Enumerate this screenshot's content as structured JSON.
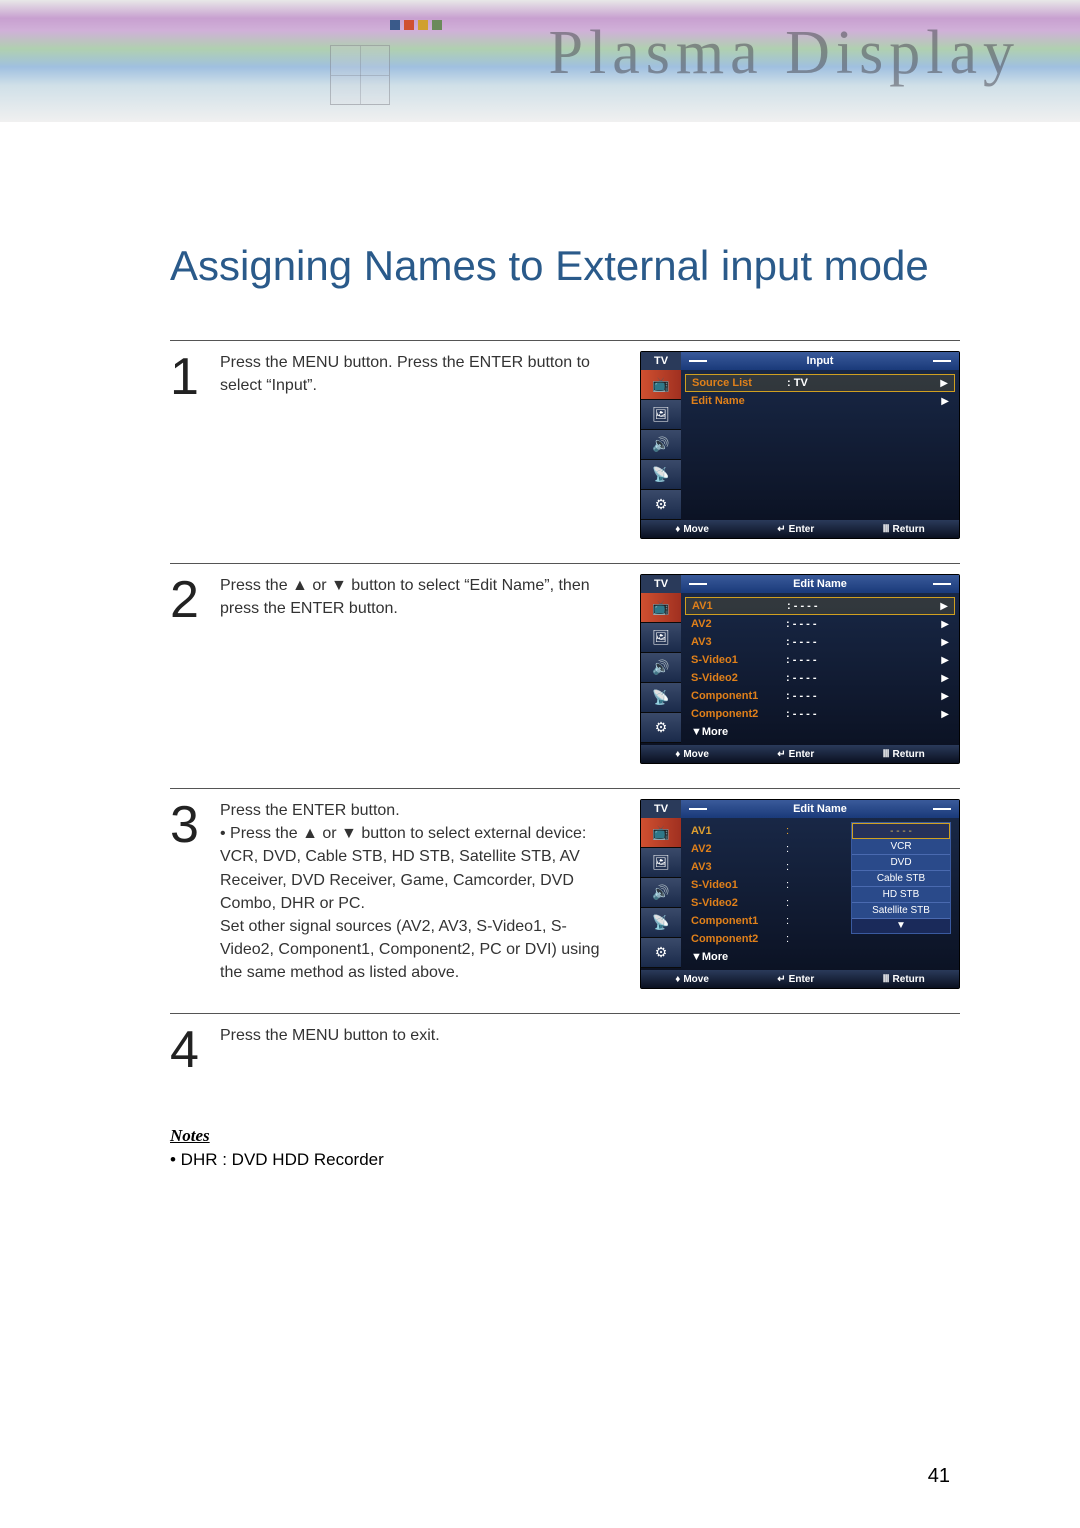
{
  "banner": {
    "title": "Plasma Display"
  },
  "page": {
    "title": "Assigning Names to External input mode",
    "pagenum": "41"
  },
  "steps": {
    "s1": {
      "num": "1",
      "text": "Press the MENU button. Press the ENTER button to select “Input”."
    },
    "s2": {
      "num": "2",
      "text": "Press the ▲ or ▼ button to select “Edit Name”, then press the ENTER button."
    },
    "s3": {
      "num": "3",
      "line1": "Press the ENTER button.",
      "line2": "• Press the ▲ or ▼ button to select external device: VCR, DVD, Cable STB, HD STB, Satellite STB, AV Receiver, DVD Receiver, Game, Camcorder, DVD Combo, DHR or PC.",
      "line3": "Set other signal sources (AV2, AV3, S-Video1, S-Video2, Component1, Component2, PC or DVI) using the same method as listed above."
    },
    "s4": {
      "num": "4",
      "text": "Press the MENU button to exit."
    }
  },
  "notes": {
    "heading": "Notes",
    "text": "•  DHR : DVD HDD Recorder"
  },
  "osd": {
    "tv_label": "TV",
    "footer": {
      "move": "Move",
      "enter": "Enter",
      "return": "Return"
    },
    "screen1": {
      "title": "Input",
      "row1_label": "Source List",
      "row1_value": ":  TV",
      "row2_label": "Edit Name"
    },
    "screen2": {
      "title": "Edit Name",
      "rows": {
        "r0": "AV1",
        "r1": "AV2",
        "r2": "AV3",
        "r3": "S-Video1",
        "r4": "S-Video2",
        "r5": "Component1",
        "r6": "Component2",
        "r7": "▼More"
      },
      "blank": ":   - - - -"
    },
    "screen3": {
      "title": "Edit Name",
      "rows": {
        "r0": "AV1",
        "r1": "AV2",
        "r2": "AV3",
        "r3": "S-Video1",
        "r4": "S-Video2",
        "r5": "Component1",
        "r6": "Component2",
        "r7": "▼More"
      },
      "colon": ":",
      "dropdown": {
        "d0": "- - - -",
        "d1": "VCR",
        "d2": "DVD",
        "d3": "Cable STB",
        "d4": "HD STB",
        "d5": "Satellite STB"
      }
    }
  }
}
